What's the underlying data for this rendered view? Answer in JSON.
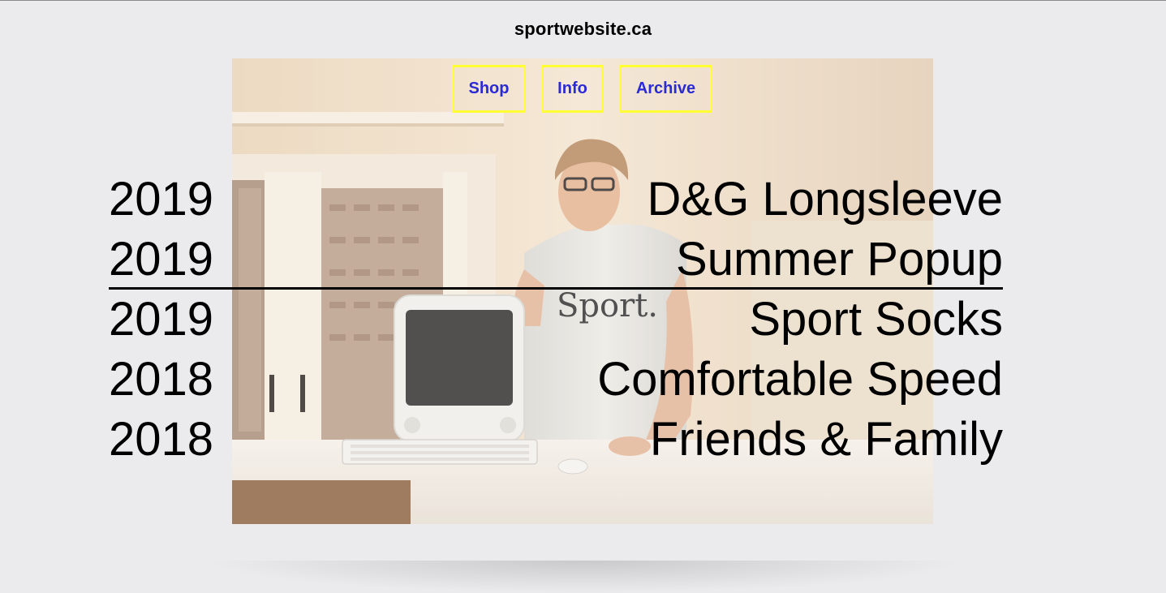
{
  "site": {
    "title": "sportwebsite.ca"
  },
  "nav": {
    "shop": "Shop",
    "info": "Info",
    "archive": "Archive"
  },
  "hero": {
    "shirt_text": "Sport."
  },
  "archive_rows": [
    {
      "year": "2019",
      "title": "D&G Longsleeve"
    },
    {
      "year": "2019",
      "title": "Summer Popup"
    },
    {
      "year": "2019",
      "title": "Sport Socks"
    },
    {
      "year": "2018",
      "title": "Comfortable Speed"
    },
    {
      "year": "2018",
      "title": "Friends & Family"
    }
  ],
  "colors": {
    "background": "#ebebed",
    "nav_text": "#2a2ad6",
    "nav_border": "#ffff33",
    "text": "#000000"
  }
}
